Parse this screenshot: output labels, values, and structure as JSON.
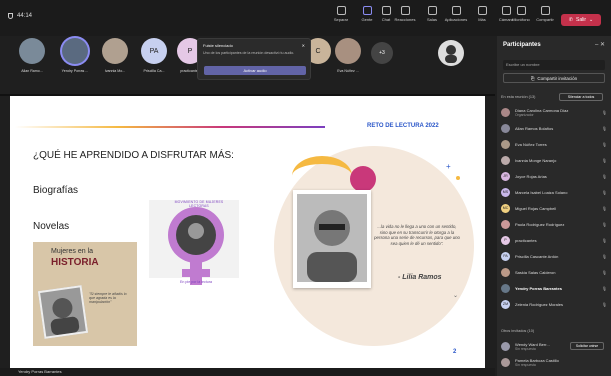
{
  "meeting": {
    "timer": "44:14"
  },
  "toolbar": [
    {
      "label": "Separar",
      "name": "separate-button"
    },
    {
      "label": "Gente",
      "name": "people-button",
      "active": true
    },
    {
      "label": "Chat",
      "name": "chat-button"
    },
    {
      "label": "Reacciones",
      "name": "reactions-button"
    },
    {
      "label": "Salas",
      "name": "rooms-button"
    },
    {
      "label": "Aplicaciones",
      "name": "apps-button"
    },
    {
      "label": "Más",
      "name": "more-button"
    },
    {
      "label": "Cámara",
      "name": "camera-button"
    },
    {
      "label": "Micrófono",
      "name": "mic-button"
    },
    {
      "label": "Compartir",
      "name": "share-button"
    }
  ],
  "leave_label": "Salir",
  "participants_strip": [
    {
      "name": "Allan Ramo...",
      "color": "#7a8a99"
    },
    {
      "name": "Yendry Porras ...",
      "color": "#5a6a80"
    },
    {
      "name": "Ivannia Mo...",
      "color": "#b0a090"
    },
    {
      "name": "Priscilla Ca...",
      "initials": "PA",
      "color": "#c7d0f0"
    },
    {
      "name": "practicantes",
      "initials": "P",
      "color": "#e5c8e6"
    },
    {
      "name": "",
      "initials": "C",
      "color": "#c9b49a"
    },
    {
      "name": "Eva Núñez ...",
      "color": "#a89080"
    }
  ],
  "more_count": "+3",
  "popup": {
    "title": "Fuiste silenciado",
    "desc": "Uno de los participantes de la reunión desactivó tu audio.",
    "button": "Activar audio"
  },
  "slide": {
    "header": "RETO DE LECTURA 2022",
    "question": "¿QUÉ HE APRENDIDO A DISFRUTAR MÁS:",
    "item1": "Biografías",
    "item2": "Novelas",
    "book_title_a": "Mujeres en la",
    "book_title_b": "HISTORIA",
    "book_quote": "\"Si siempre le añadís lo que agrada es la manipulación\"",
    "logo_text": "MOVIMIENTO DE MUJERES LECTORAS",
    "logo_sub": "En pie por la lectura",
    "quote": "...la vida no le llega a uno con un sentido, sino que en su transcurrir le otorga a la persona una serie de recursos, para que uno sea quien le dé un sentido\".",
    "author": "- Lilia Ramos",
    "page": "2"
  },
  "bottom_name": "Yendry Porras Barrantes",
  "panel": {
    "title": "Participantes",
    "search_placeholder": "Escribe un nombre",
    "share_label": "Compartir invitación",
    "in_meeting": "En esta reunión (13)",
    "silence_all": "Silenciar a todos",
    "people": [
      {
        "name": "Diana Carolina Carmona Díaz",
        "sub": "Organizador",
        "color": "#a88"
      },
      {
        "name": "Allan Ramos Bolaños",
        "color": "#889"
      },
      {
        "name": "Eva Núñez Torres",
        "color": "#a98"
      },
      {
        "name": "Ivannia Monge Naranjo",
        "color": "#baa"
      },
      {
        "name": "Joyce Rojas Arias",
        "initials": "JR",
        "color": "#d8b6e0"
      },
      {
        "name": "Marcela Isabel Loaiza Solano",
        "initials": "MS",
        "color": "#c8b6ea"
      },
      {
        "name": "Miguel Rojas Campbell",
        "initials": "MC",
        "color": "#f0d080"
      },
      {
        "name": "Paola Rodríguez Rodríguez",
        "color": "#c99"
      },
      {
        "name": "practicantes",
        "initials": "P",
        "color": "#e5c8e6"
      },
      {
        "name": "Priscilla Cascante Ardón",
        "initials": "PA",
        "color": "#c7d0f0"
      },
      {
        "name": "Saskia Salas Calderon",
        "color": "#b98"
      },
      {
        "name": "Yendry Porras Barrantes",
        "color": "#678",
        "bold": true
      },
      {
        "name": "Zelenia Rodríguez Morales",
        "initials": "ZM",
        "color": "#c7d0f0"
      }
    ],
    "invited": "Otros invitados (10)",
    "invited_people": [
      {
        "name": "Wendy Ward Berr...",
        "sub": "Sin respuesta",
        "color": "#99a"
      },
      {
        "name": "Pamela Barboza Castillo",
        "sub": "Sin respuesta",
        "color": "#a99"
      }
    ],
    "accept_label": "Solicitar unirse"
  }
}
